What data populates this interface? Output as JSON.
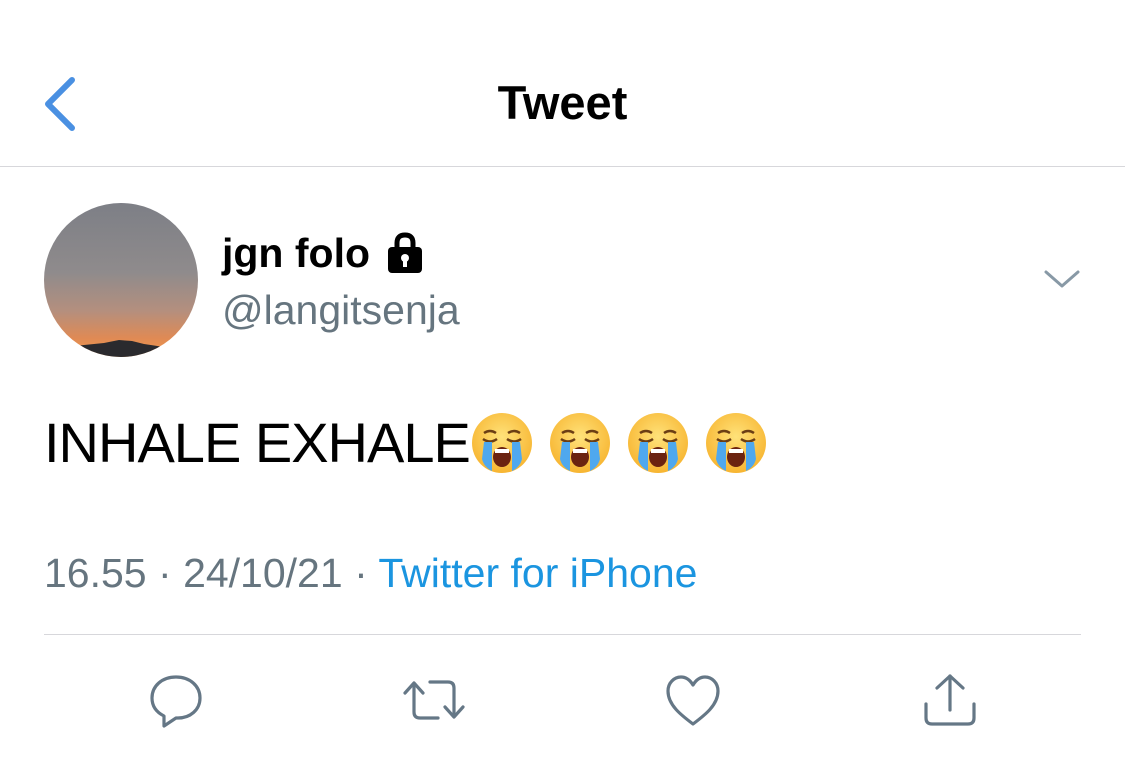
{
  "nav": {
    "title": "Tweet",
    "back_icon": "chevron-left-icon",
    "accent": "#4a90e2"
  },
  "author": {
    "display_name": "jgn folo",
    "handle": "@langitsenja",
    "protected_icon": "lock-icon",
    "menu_icon": "chevron-down-icon"
  },
  "tweet": {
    "text": "INHALE EXHALE",
    "emojis": [
      "😭",
      "😭",
      "😭",
      "😭"
    ]
  },
  "meta": {
    "time": "16.55",
    "separator": "·",
    "date": "24/10/21",
    "source": "Twitter for iPhone",
    "source_color": "#1b95e0"
  },
  "actions": [
    {
      "icon": "reply-icon"
    },
    {
      "icon": "retweet-icon"
    },
    {
      "icon": "like-icon"
    },
    {
      "icon": "share-icon"
    }
  ]
}
